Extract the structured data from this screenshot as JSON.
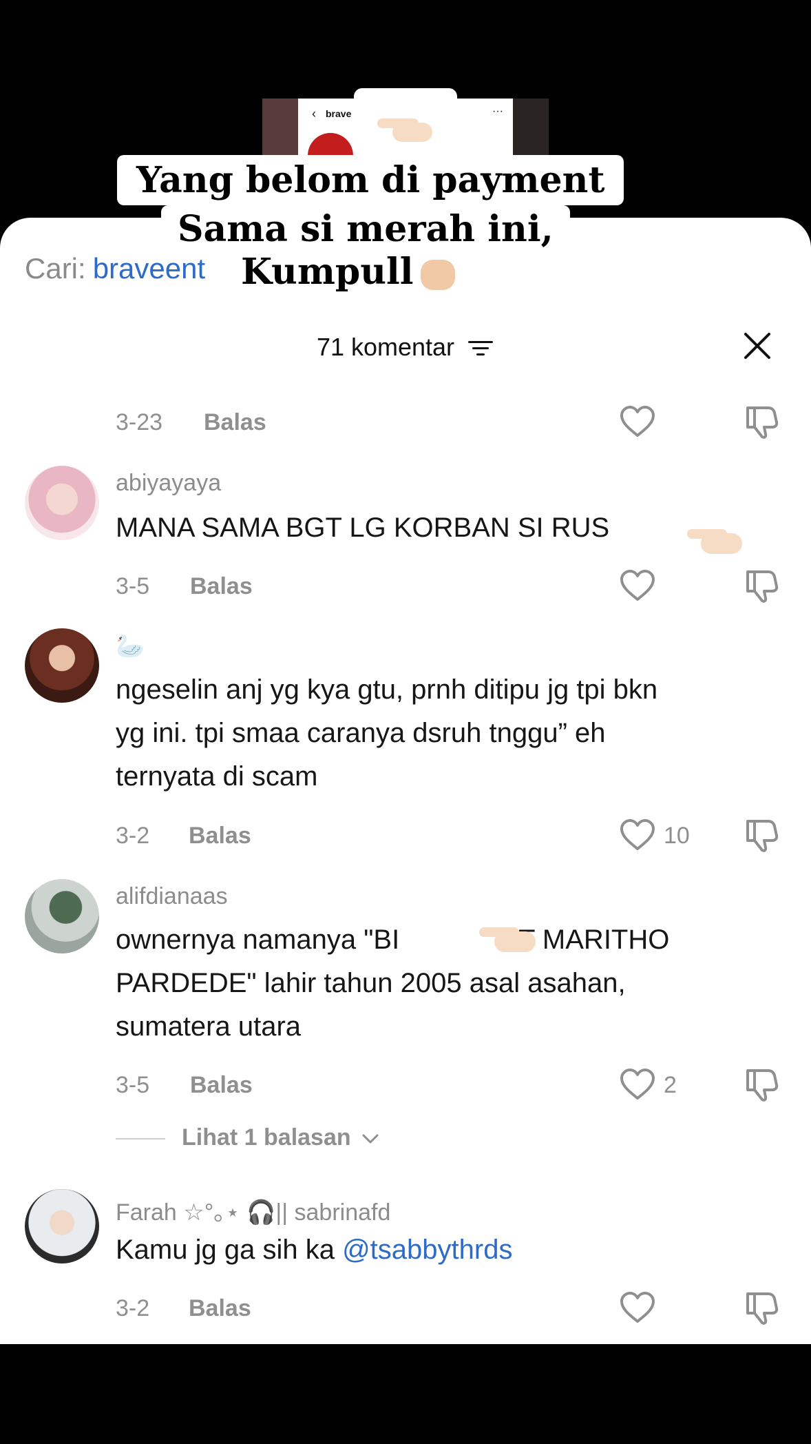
{
  "video": {
    "thumb_title": "brave"
  },
  "overlay_caption": {
    "line1": "Yang belom di payment",
    "line2": "Sama si merah ini,",
    "line3": "Kumpull"
  },
  "search": {
    "label": "Cari:",
    "query": "braveent"
  },
  "sheet": {
    "title": "71 komentar"
  },
  "comments": [
    {
      "date": "3-23",
      "reply": "Balas",
      "likes": ""
    },
    {
      "username": "abiyayaya",
      "text": [
        "MANA SAMA BGT LG KORBAN SI RUS"
      ],
      "date": "3-5",
      "reply": "Balas",
      "likes": ""
    },
    {
      "username": "🦢",
      "text": [
        "ngeselin anj yg kya gtu, prnh ditipu jg tpi bkn",
        "yg ini. tpi smaa caranya dsruh tnggu” eh",
        "ternyata di scam"
      ],
      "date": "3-2",
      "reply": "Balas",
      "likes": "10"
    },
    {
      "username": "alifdianaas",
      "text": [
        "ownernya namanya \"BI",
        "UT MARITHO",
        "PARDEDE\" lahir tahun 2005 asal asahan,",
        "sumatera utara"
      ],
      "date": "3-5",
      "reply": "Balas",
      "likes": "2",
      "more_replies": "Lihat 1 balasan"
    },
    {
      "username": "Farah ☆°｡⋆ 🎧|| sabrinafd",
      "text_prefix": "Kamu jg ga sih ka ",
      "mention": "@tsabbythrds",
      "date": "3-2",
      "reply": "Balas",
      "likes": ""
    }
  ],
  "colors": {
    "link": "#2e6bc6",
    "muted": "#8f8f8f",
    "sheet_bg": "#ffffff",
    "backdrop": "#000000"
  }
}
